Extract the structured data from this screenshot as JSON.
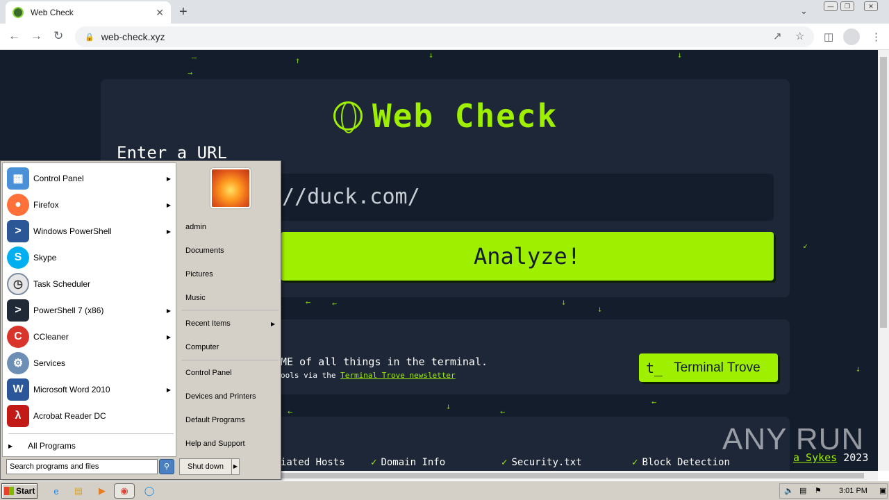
{
  "browser": {
    "tab_title": "Web Check",
    "url": "web-check.xyz",
    "tab_close": "✕",
    "new_tab": "+"
  },
  "page": {
    "title": "Web Check",
    "url_label": "Enter a URL",
    "input_value": "//duck.com/",
    "analyze_label": "Analyze!",
    "promo_main": "ME of all things in the terminal.",
    "promo_sub": "ools via the",
    "promo_link": "Terminal Trove newsletter",
    "terminal_trove_label": "Terminal Trove",
    "terminal_trove_icon": "t_",
    "features": [
      "iated Hosts",
      "Domain Info",
      "Security.txt",
      "Block Detection"
    ],
    "credit_name": "a Sykes",
    "credit_year": "2023",
    "watermark": "ANY RUN"
  },
  "start_menu": {
    "left_items": [
      {
        "label": "Control Panel",
        "icon": "control-panel-icon",
        "color": "#4a90d9",
        "has_arrow": true
      },
      {
        "label": "Firefox",
        "icon": "firefox-icon",
        "color": "#ff7139",
        "has_arrow": true
      },
      {
        "label": "Windows PowerShell",
        "icon": "powershell-icon",
        "color": "#2b5797",
        "has_arrow": true
      },
      {
        "label": "Skype",
        "icon": "skype-icon",
        "color": "#00aff0",
        "has_arrow": false
      },
      {
        "label": "Task Scheduler",
        "icon": "task-scheduler-icon",
        "color": "#7a8ca0",
        "has_arrow": false
      },
      {
        "label": "PowerShell 7 (x86)",
        "icon": "powershell7-icon",
        "color": "#1f2a36",
        "has_arrow": true
      },
      {
        "label": "CCleaner",
        "icon": "ccleaner-icon",
        "color": "#d9342b",
        "has_arrow": true
      },
      {
        "label": "Services",
        "icon": "services-icon",
        "color": "#6d8fb5",
        "has_arrow": false
      },
      {
        "label": "Microsoft Word 2010",
        "icon": "word-icon",
        "color": "#2b579a",
        "has_arrow": true
      },
      {
        "label": "Acrobat Reader DC",
        "icon": "acrobat-icon",
        "color": "#c21b17",
        "has_arrow": false
      }
    ],
    "all_programs": "All Programs",
    "search_placeholder": "Search programs and files",
    "right_items": [
      "admin",
      "Documents",
      "Pictures",
      "Music",
      "Recent Items",
      "Computer",
      "Control Panel",
      "Devices and Printers",
      "Default Programs",
      "Help and Support"
    ],
    "shutdown_label": "Shut down"
  },
  "taskbar": {
    "start_label": "Start",
    "clock": "3:01 PM"
  },
  "colors": {
    "accent": "#9fef00",
    "page_bg": "#141d2b",
    "card_bg": "#1d2738"
  }
}
